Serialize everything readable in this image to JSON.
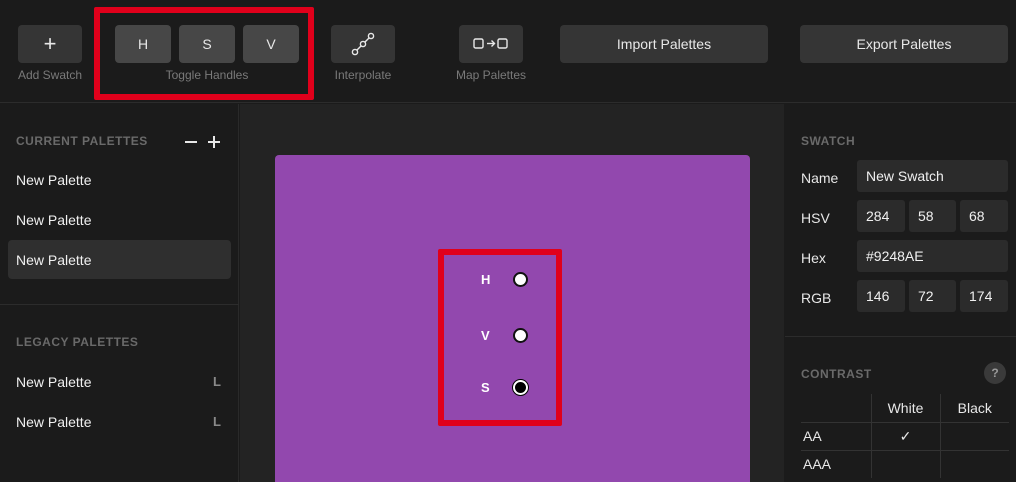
{
  "toolbar": {
    "add_swatch": {
      "icon": "plus-icon",
      "glyph": "+",
      "label": "Add Swatch"
    },
    "toggle_handles": {
      "buttons": [
        "H",
        "S",
        "V"
      ],
      "label": "Toggle Handles"
    },
    "interpolate": {
      "icon": "interpolate-icon",
      "label": "Interpolate"
    },
    "map_palettes": {
      "icon": "map-palettes-icon",
      "label": "Map Palettes"
    },
    "import_label": "Import Palettes",
    "export_label": "Export Palettes"
  },
  "sidebar": {
    "current_title": "CURRENT PALETTES",
    "current_palettes": [
      {
        "name": "New Palette",
        "selected": false
      },
      {
        "name": "New Palette",
        "selected": false
      },
      {
        "name": "New Palette",
        "selected": true
      }
    ],
    "legacy_title": "LEGACY PALETTES",
    "legacy_palettes": [
      {
        "name": "New Palette",
        "tag": "L"
      },
      {
        "name": "New Palette",
        "tag": "L"
      }
    ]
  },
  "canvas": {
    "swatch_color": "#9248AE",
    "handles": [
      {
        "label": "H",
        "style": "hollow"
      },
      {
        "label": "V",
        "style": "hollow"
      },
      {
        "label": "S",
        "style": "filled"
      }
    ]
  },
  "swatch_panel": {
    "title": "SWATCH",
    "name_label": "Name",
    "name_value": "New Swatch",
    "hsv_label": "HSV",
    "hsv": [
      "284",
      "58",
      "68"
    ],
    "hex_label": "Hex",
    "hex_value": "#9248AE",
    "rgb_label": "RGB",
    "rgb": [
      "146",
      "72",
      "174"
    ]
  },
  "contrast_panel": {
    "title": "CONTRAST",
    "help": "?",
    "columns": [
      "White",
      "Black"
    ],
    "rows": [
      {
        "level": "AA",
        "white": "✓",
        "black": ""
      },
      {
        "level": "AAA",
        "white": "",
        "black": ""
      }
    ]
  },
  "colors": {
    "highlight": "#e0001b",
    "background": "#1b1b1b",
    "button": "#353535"
  }
}
